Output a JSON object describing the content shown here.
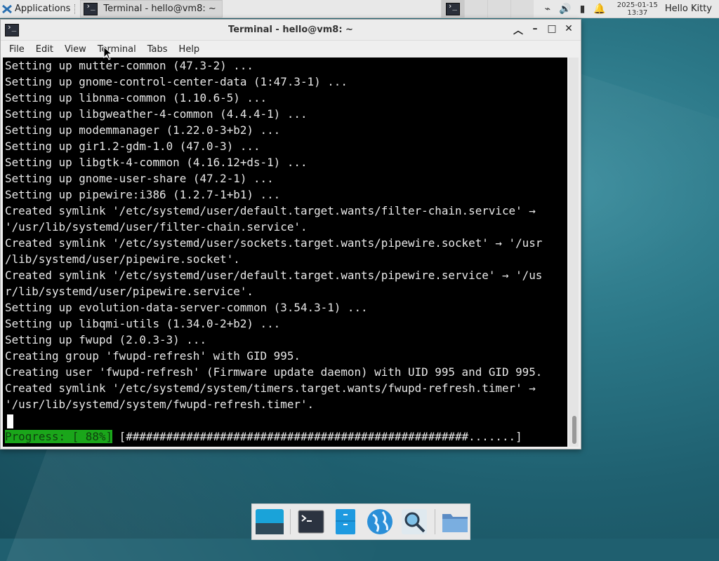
{
  "top_panel": {
    "applications_label": "Applications",
    "task_title": "Terminal - hello@vm8: ~",
    "clock_date": "2025-01-15",
    "clock_time": "13:37",
    "user_label": "Hello Kitty",
    "tray_icons": [
      "network-icon",
      "volume-icon",
      "battery-icon",
      "notification-bell-icon"
    ]
  },
  "window": {
    "title": "Terminal - hello@vm8: ~",
    "menu": [
      "File",
      "Edit",
      "View",
      "Terminal",
      "Tabs",
      "Help"
    ]
  },
  "terminal": {
    "lines": [
      "Setting up mutter-common (47.3-2) ...",
      "Setting up gnome-control-center-data (1:47.3-1) ...",
      "Setting up libnma-common (1.10.6-5) ...",
      "Setting up libgweather-4-common (4.4.4-1) ...",
      "Setting up modemmanager (1.22.0-3+b2) ...",
      "Setting up gir1.2-gdm-1.0 (47.0-3) ...",
      "Setting up libgtk-4-common (4.16.12+ds-1) ...",
      "Setting up gnome-user-share (47.2-1) ...",
      "Setting up pipewire:i386 (1.2.7-1+b1) ...",
      "Created symlink '/etc/systemd/user/default.target.wants/filter-chain.service' →",
      "'/usr/lib/systemd/user/filter-chain.service'.",
      "Created symlink '/etc/systemd/user/sockets.target.wants/pipewire.socket' → '/usr",
      "/lib/systemd/user/pipewire.socket'.",
      "Created symlink '/etc/systemd/user/default.target.wants/pipewire.service' → '/us",
      "r/lib/systemd/user/pipewire.service'.",
      "Setting up evolution-data-server-common (3.54.3-1) ...",
      "Setting up libqmi-utils (1.34.0-2+b2) ...",
      "Setting up fwupd (2.0.3-3) ...",
      "Creating group 'fwupd-refresh' with GID 995.",
      "Creating user 'fwupd-refresh' (Firmware update daemon) with UID 995 and GID 995.",
      "Created symlink '/etc/systemd/system/timers.target.wants/fwupd-refresh.timer' →",
      "'/usr/lib/systemd/system/fwupd-refresh.timer'."
    ],
    "progress_label": "Progress: [ 88%]",
    "progress_bar": " [###################################################.......]",
    "progress_percent": 88
  },
  "dock": {
    "items": [
      "show-desktop-icon",
      "terminal-icon",
      "file-manager-icon",
      "web-browser-icon",
      "app-finder-icon",
      "folder-icon"
    ]
  }
}
